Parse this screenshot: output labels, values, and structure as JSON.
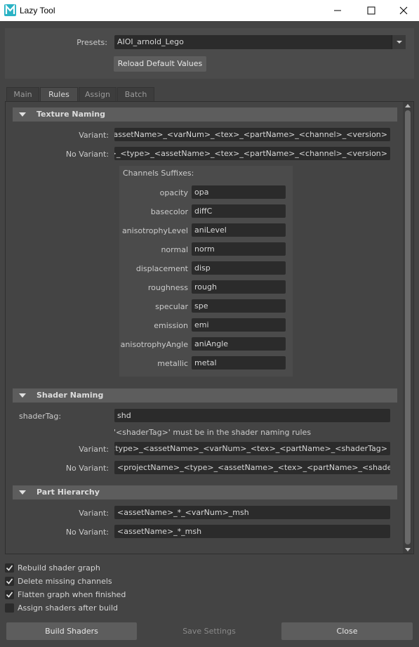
{
  "window": {
    "title": "Lazy Tool",
    "app_icon": "maya-icon",
    "minimize_icon": "minimize-icon",
    "maximize_icon": "maximize-icon",
    "close_icon": "close-icon"
  },
  "presets": {
    "label": "Presets:",
    "value": "AIOI_arnold_Lego",
    "reload_button": "Reload Default Values"
  },
  "tabs": [
    {
      "label": "Main",
      "active": false
    },
    {
      "label": "Rules",
      "active": true
    },
    {
      "label": "Assign",
      "active": false
    },
    {
      "label": "Batch",
      "active": false
    }
  ],
  "texture_naming": {
    "title": "Texture Naming",
    "variant_label": "Variant:",
    "variant_value": "<type>_<assetName>_<varNum>_<tex>_<partName>_<channel>_<version>",
    "novariant_label": "No Variant:",
    "novariant_value": "<projectName>_<type>_<assetName>_<tex>_<partName>_<channel>_<version>",
    "channels_title": "Channels Suffixes:",
    "channels": [
      {
        "name": "opacity",
        "value": "opa"
      },
      {
        "name": "basecolor",
        "value": "diffC"
      },
      {
        "name": "anisotrophyLevel",
        "value": "aniLevel"
      },
      {
        "name": "normal",
        "value": "norm"
      },
      {
        "name": "displacement",
        "value": "disp"
      },
      {
        "name": "roughness",
        "value": "rough"
      },
      {
        "name": "specular",
        "value": "spe"
      },
      {
        "name": "emission",
        "value": "emi"
      },
      {
        "name": "anisotrophyAngle",
        "value": "aniAngle"
      },
      {
        "name": "metallic",
        "value": "metal"
      }
    ]
  },
  "shader_naming": {
    "title": "Shader Naming",
    "tag_label": "shaderTag:",
    "tag_value": "shd",
    "note": "'<shaderTag>' must be in the shader naming rules",
    "variant_label": "Variant:",
    "variant_value": "<type>_<assetName>_<varNum>_<tex>_<partName>_<shaderTag>",
    "novariant_label": "No Variant:",
    "novariant_value": "<projectName>_<type>_<assetName>_<tex>_<partName>_<shaderTag>"
  },
  "part_hierarchy": {
    "title": "Part Hierarchy",
    "variant_label": "Variant:",
    "variant_value": "<assetName>_*_<varNum>_msh",
    "novariant_label": "No Variant:",
    "novariant_value": "<assetName>_*_msh"
  },
  "options": [
    {
      "label": "Rebuild shader graph",
      "checked": true
    },
    {
      "label": "Delete missing channels",
      "checked": true
    },
    {
      "label": "Flatten graph when finished",
      "checked": true
    },
    {
      "label": "Assign shaders after build",
      "checked": false
    }
  ],
  "buttons": {
    "build": "Build Shaders",
    "save": "Save Settings",
    "close": "Close"
  },
  "colors": {
    "window_bg": "#444444",
    "field_bg": "#2b2b2b",
    "section_bg": "#5d5d5d",
    "maya_accent": "#2bb3c5"
  }
}
